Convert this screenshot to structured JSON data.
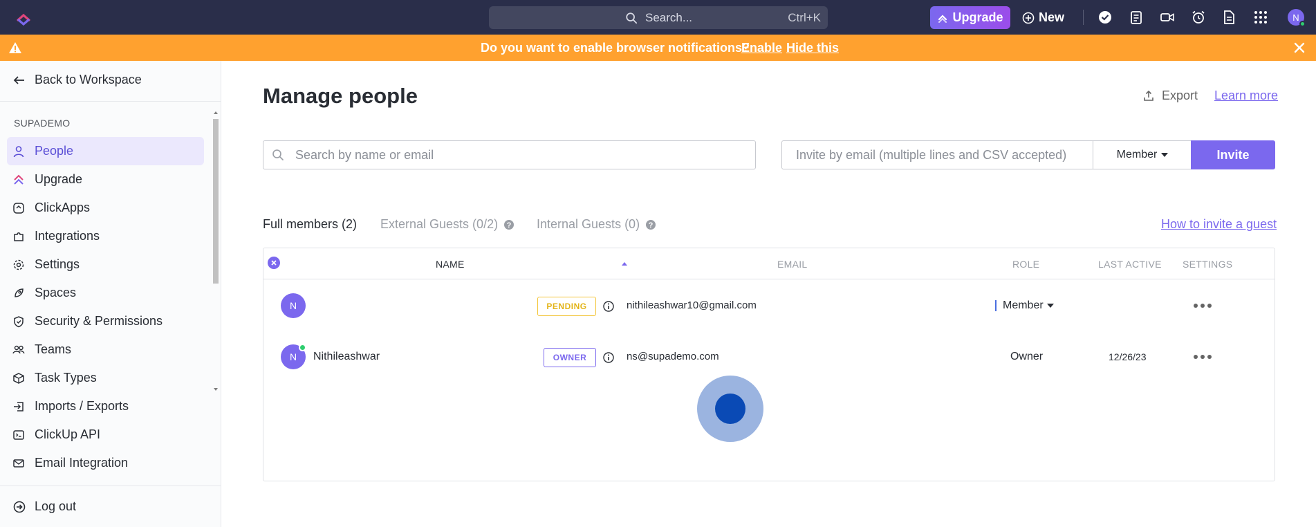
{
  "topbar": {
    "search_label": "Search...",
    "search_shortcut": "Ctrl+K",
    "upgrade_label": "Upgrade",
    "new_label": "New",
    "avatar_initial": "N"
  },
  "banner": {
    "message": "Do you want to enable browser notifications?",
    "enable_label": "Enable",
    "hide_label": "Hide this"
  },
  "sidebar": {
    "back_label": "Back to Workspace",
    "workspace_label": "SUPADEMO",
    "items": [
      {
        "label": "People",
        "icon": "person-icon"
      },
      {
        "label": "Upgrade",
        "icon": "upgrade-icon"
      },
      {
        "label": "ClickApps",
        "icon": "clickapps-icon"
      },
      {
        "label": "Integrations",
        "icon": "puzzle-icon"
      },
      {
        "label": "Settings",
        "icon": "gear-icon"
      },
      {
        "label": "Spaces",
        "icon": "rocket-icon"
      },
      {
        "label": "Security & Permissions",
        "icon": "shield-icon"
      },
      {
        "label": "Teams",
        "icon": "team-icon"
      },
      {
        "label": "Task Types",
        "icon": "cube-icon"
      },
      {
        "label": "Imports / Exports",
        "icon": "import-icon"
      },
      {
        "label": "ClickUp API",
        "icon": "api-icon"
      },
      {
        "label": "Email Integration",
        "icon": "mail-icon"
      }
    ],
    "logout_label": "Log out"
  },
  "main": {
    "title": "Manage people",
    "export_label": "Export",
    "learn_more_label": "Learn more",
    "search_placeholder": "Search by name or email",
    "invite_placeholder": "Invite by email (multiple lines and CSV accepted)",
    "role_select_value": "Member",
    "invite_label": "Invite",
    "tabs": [
      {
        "label": "Full members (2)",
        "active": true
      },
      {
        "label": "External Guests (0/2)",
        "active": false
      },
      {
        "label": "Internal Guests (0)",
        "active": false
      }
    ],
    "how_to_invite_label": "How to invite a guest"
  },
  "table": {
    "headers": {
      "name": "NAME",
      "email": "EMAIL",
      "role": "ROLE",
      "last_active": "LAST ACTIVE",
      "settings": "SETTINGS"
    },
    "rows": [
      {
        "initial": "N",
        "name": "",
        "badge": "PENDING",
        "email": "nithileashwar10@gmail.com",
        "role": "Member",
        "last_active": "",
        "online": false
      },
      {
        "initial": "N",
        "name": "Nithileashwar",
        "badge": "OWNER",
        "email": "ns@supademo.com",
        "role": "Owner",
        "last_active": "12/26/23",
        "online": true
      }
    ]
  },
  "colors": {
    "accent": "#7b68ee",
    "topbar": "#2a2e4a",
    "banner": "#ffa12f",
    "pending": "#f3c537",
    "online": "#2ecd6f"
  }
}
